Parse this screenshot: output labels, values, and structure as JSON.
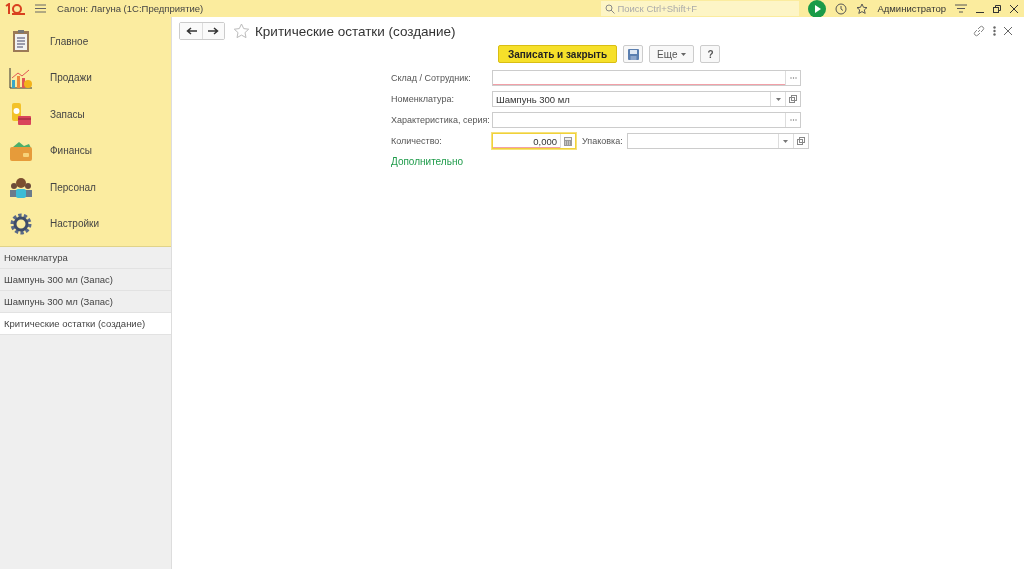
{
  "app": {
    "title": "Салон: Лагуна  (1С:Предприятие)",
    "search_placeholder": "Поиск Ctrl+Shift+F",
    "user": "Администратор"
  },
  "sections": [
    {
      "label": "Главное"
    },
    {
      "label": "Продажи"
    },
    {
      "label": "Запасы"
    },
    {
      "label": "Финансы"
    },
    {
      "label": "Персонал"
    },
    {
      "label": "Настройки"
    }
  ],
  "open_windows": [
    {
      "label": "Номенклатура",
      "selected": false
    },
    {
      "label": "Шампунь 300 мл (Запас)",
      "selected": false
    },
    {
      "label": "Шампунь 300 мл (Запас)",
      "selected": false
    },
    {
      "label": "Критические остатки (создание)",
      "selected": true
    }
  ],
  "form": {
    "title": "Критические остатки (создание)",
    "favorite": false,
    "save_close": "Записать и закрыть",
    "more": "Еще",
    "help": "?",
    "rows": [
      {
        "fields": [
          {
            "label": "Склад / Сотрудник:",
            "kind": "choice",
            "required": true,
            "focused": false
          }
        ]
      },
      {
        "fields": [
          {
            "label": "Номенклатура:",
            "value": "Шампунь 300 мл",
            "kind": "select",
            "required": false,
            "focused": false
          }
        ]
      },
      {
        "fields": [
          {
            "label": "Характеристика, серия:",
            "kind": "choice",
            "required": false,
            "focused": false
          }
        ]
      },
      {
        "fields": [
          {
            "label": "Количество:",
            "value": "0,000",
            "kind": "number",
            "required": true,
            "focused": true
          },
          {
            "label": "Упаковка:",
            "kind": "select",
            "required": false,
            "focused": false
          }
        ]
      }
    ],
    "more_link": "Дополнительно"
  }
}
